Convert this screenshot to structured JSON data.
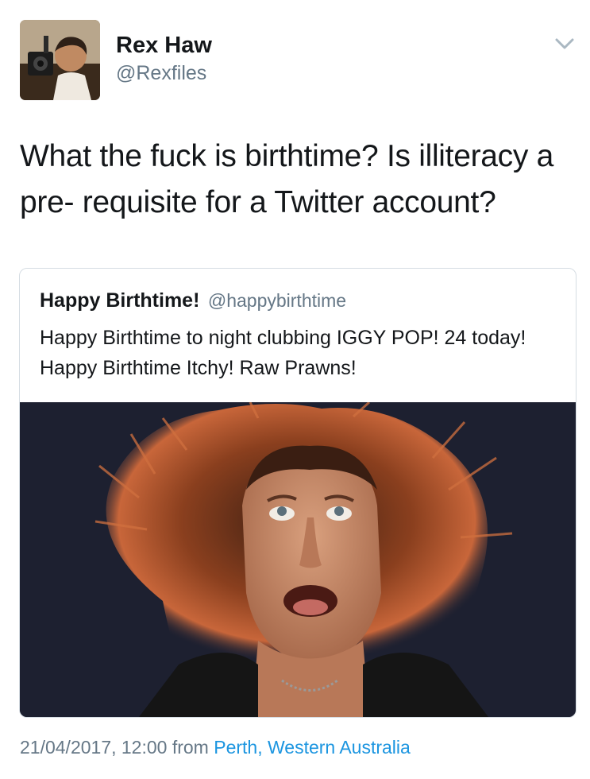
{
  "author": {
    "display_name": "Rex Haw",
    "handle": "@Rexfiles",
    "avatar_icon": "avatar-photo"
  },
  "menu": {
    "icon": "chevron-down-icon"
  },
  "tweet": {
    "text": "What the fuck is birthtime?  Is illiteracy a pre- requisite for a Twitter account?"
  },
  "quoted_tweet": {
    "display_name": "Happy Birthtime!",
    "handle": "@happybirthtime",
    "text": "Happy Birthtime to night clubbing IGGY POP! 24 today! Happy Birthtime Itchy! Raw Prawns!",
    "photo_icon": "attached-photo"
  },
  "meta": {
    "timestamp": "21/04/2017, 12:00",
    "from_label": "from",
    "location": "Perth, Western Australia"
  },
  "colors": {
    "primary_text": "#14171a",
    "secondary_text": "#657786",
    "link": "#1b95e0",
    "border": "#d6dde3"
  }
}
